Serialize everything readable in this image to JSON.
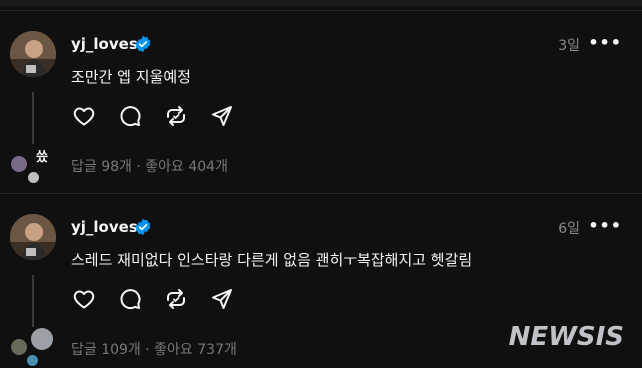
{
  "posts": [
    {
      "username": "yj_loves",
      "time": "3일",
      "text": "조만간 엡 지울예정",
      "replies": "답글 98개",
      "separator": "·",
      "likes": "좋아요 404개",
      "reply_avatar_text": "씄"
    },
    {
      "username": "yj_loves",
      "time": "6일",
      "text": "스레드 재미없다 인스타랑 다른게 없음 괜히ㅜ복잡해지고 헷갈림",
      "replies": "답글 109개",
      "separator": "·",
      "likes": "좋아요 737개"
    }
  ],
  "more_label": "•••",
  "watermark": "NEWSIS",
  "colors": {
    "background": "#101010",
    "verified": "#0095f6",
    "muted": "#777777"
  },
  "icons": [
    "heart-icon",
    "comment-icon",
    "repost-icon",
    "share-icon",
    "verified-badge-icon",
    "more-icon"
  ]
}
